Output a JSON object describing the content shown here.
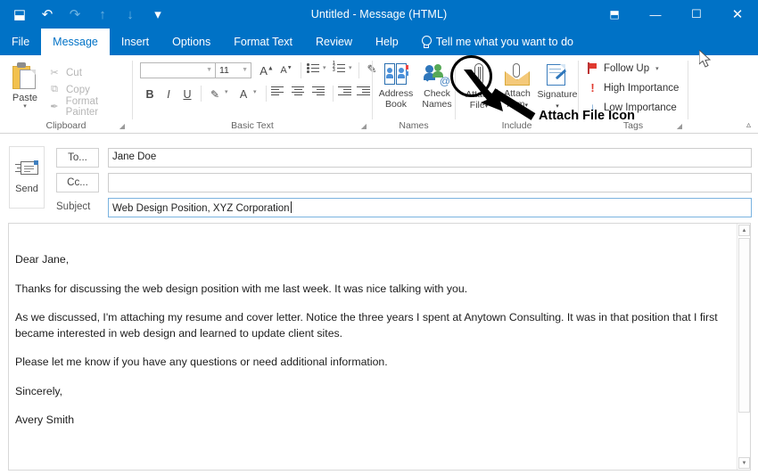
{
  "window": {
    "title": "Untitled  -  Message (HTML)",
    "quick_access": [
      {
        "name": "save-icon",
        "glyph": "⬓",
        "dim": false
      },
      {
        "name": "undo-icon",
        "glyph": "↶",
        "dim": false
      },
      {
        "name": "redo-icon",
        "glyph": "↷",
        "dim": true
      },
      {
        "name": "up-icon",
        "glyph": "↑",
        "dim": true
      },
      {
        "name": "down-icon",
        "glyph": "↓",
        "dim": true
      },
      {
        "name": "customize-qat-icon",
        "glyph": "▾",
        "dim": false
      }
    ],
    "controls": {
      "ribbon_display": "⬒",
      "minimize": "—",
      "maximize": "☐",
      "close": "✕"
    }
  },
  "tabs": [
    {
      "label": "File",
      "active": false
    },
    {
      "label": "Message",
      "active": true
    },
    {
      "label": "Insert",
      "active": false
    },
    {
      "label": "Options",
      "active": false
    },
    {
      "label": "Format Text",
      "active": false
    },
    {
      "label": "Review",
      "active": false
    },
    {
      "label": "Help",
      "active": false
    }
  ],
  "tell_me": "Tell me what you want to do",
  "ribbon": {
    "clipboard": {
      "group_label": "Clipboard",
      "paste_label": "Paste",
      "commands": [
        {
          "label": "Cut",
          "icon": "scissors-icon",
          "glyph": "✂"
        },
        {
          "label": "Copy",
          "icon": "copy-icon",
          "glyph": "⧉"
        },
        {
          "label": "Format Painter",
          "icon": "format-painter-icon",
          "glyph": "✒"
        }
      ]
    },
    "basic_text": {
      "group_label": "Basic Text",
      "font_name": "",
      "font_size": "11",
      "grow_font": "A",
      "shrink_font": "A",
      "bold": "B",
      "italic": "I",
      "underline": "U",
      "font_color": "A"
    },
    "names": {
      "group_label": "Names",
      "address_book": "Address\nBook",
      "address_book_l1": "Address",
      "address_book_l2": "Book",
      "check_names_l1": "Check",
      "check_names_l2": "Names"
    },
    "include": {
      "group_label": "Include",
      "attach_file_l1": "Attach",
      "attach_file_l2": "File",
      "attach_item_l1": "Attach",
      "attach_item_l2": "Item",
      "signature_l1": "Signature"
    },
    "tags": {
      "group_label": "Tags",
      "follow_up": "Follow Up",
      "high_importance": "High Importance",
      "low_importance": "Low Importance"
    }
  },
  "compose": {
    "send_label": "Send",
    "to_label": "To...",
    "to_value": "Jane Doe",
    "cc_label": "Cc...",
    "cc_value": "",
    "subject_label": "Subject",
    "subject_value": "Web Design Position, XYZ Corporation",
    "body": [
      "Dear Jane,",
      "Thanks for discussing the web design position with me last week. It was nice talking with you.",
      "As we discussed, I'm attaching my resume and cover letter. Notice the three years I spent at Anytown Consulting. It was in that position that I first became interested in web design and learned to update client sites.",
      "Please let me know if you have any questions or need additional information.",
      "Sincerely,",
      "Avery Smith"
    ]
  },
  "annotation": {
    "label": "Attach File Icon"
  },
  "colors": {
    "accent": "#0072c6",
    "annotation": "#000000",
    "subject_border": "#7ab3e0"
  }
}
